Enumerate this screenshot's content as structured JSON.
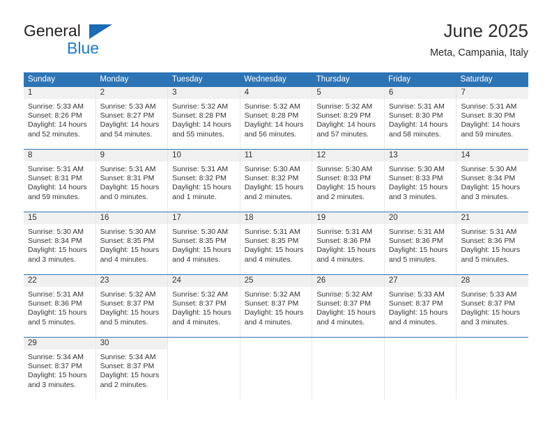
{
  "brand": {
    "name_part1": "General",
    "name_part2": "Blue",
    "accent_color": "#1b7ad1",
    "triangle_color": "#1b6cb5"
  },
  "header": {
    "title": "June 2025",
    "subtitle": "Meta, Campania, Italy"
  },
  "theme": {
    "header_blue": "#2d74b5",
    "daynum_strip": "#f0f0f0",
    "grid_line": "#e7e7e7",
    "text": "#333333"
  },
  "weekdays": [
    "Sunday",
    "Monday",
    "Tuesday",
    "Wednesday",
    "Thursday",
    "Friday",
    "Saturday"
  ],
  "labels": {
    "sunrise_prefix": "Sunrise:",
    "sunset_prefix": "Sunset:",
    "daylight_prefix": "Daylight:"
  },
  "weeks": [
    [
      {
        "day": "1",
        "sunrise": "Sunrise: 5:33 AM",
        "sunset": "Sunset: 8:26 PM",
        "daylight_line1": "Daylight: 14 hours",
        "daylight_line2": "and 52 minutes."
      },
      {
        "day": "2",
        "sunrise": "Sunrise: 5:33 AM",
        "sunset": "Sunset: 8:27 PM",
        "daylight_line1": "Daylight: 14 hours",
        "daylight_line2": "and 54 minutes."
      },
      {
        "day": "3",
        "sunrise": "Sunrise: 5:32 AM",
        "sunset": "Sunset: 8:28 PM",
        "daylight_line1": "Daylight: 14 hours",
        "daylight_line2": "and 55 minutes."
      },
      {
        "day": "4",
        "sunrise": "Sunrise: 5:32 AM",
        "sunset": "Sunset: 8:28 PM",
        "daylight_line1": "Daylight: 14 hours",
        "daylight_line2": "and 56 minutes."
      },
      {
        "day": "5",
        "sunrise": "Sunrise: 5:32 AM",
        "sunset": "Sunset: 8:29 PM",
        "daylight_line1": "Daylight: 14 hours",
        "daylight_line2": "and 57 minutes."
      },
      {
        "day": "6",
        "sunrise": "Sunrise: 5:31 AM",
        "sunset": "Sunset: 8:30 PM",
        "daylight_line1": "Daylight: 14 hours",
        "daylight_line2": "and 58 minutes."
      },
      {
        "day": "7",
        "sunrise": "Sunrise: 5:31 AM",
        "sunset": "Sunset: 8:30 PM",
        "daylight_line1": "Daylight: 14 hours",
        "daylight_line2": "and 59 minutes."
      }
    ],
    [
      {
        "day": "8",
        "sunrise": "Sunrise: 5:31 AM",
        "sunset": "Sunset: 8:31 PM",
        "daylight_line1": "Daylight: 14 hours",
        "daylight_line2": "and 59 minutes."
      },
      {
        "day": "9",
        "sunrise": "Sunrise: 5:31 AM",
        "sunset": "Sunset: 8:31 PM",
        "daylight_line1": "Daylight: 15 hours",
        "daylight_line2": "and 0 minutes."
      },
      {
        "day": "10",
        "sunrise": "Sunrise: 5:31 AM",
        "sunset": "Sunset: 8:32 PM",
        "daylight_line1": "Daylight: 15 hours",
        "daylight_line2": "and 1 minute."
      },
      {
        "day": "11",
        "sunrise": "Sunrise: 5:30 AM",
        "sunset": "Sunset: 8:32 PM",
        "daylight_line1": "Daylight: 15 hours",
        "daylight_line2": "and 2 minutes."
      },
      {
        "day": "12",
        "sunrise": "Sunrise: 5:30 AM",
        "sunset": "Sunset: 8:33 PM",
        "daylight_line1": "Daylight: 15 hours",
        "daylight_line2": "and 2 minutes."
      },
      {
        "day": "13",
        "sunrise": "Sunrise: 5:30 AM",
        "sunset": "Sunset: 8:33 PM",
        "daylight_line1": "Daylight: 15 hours",
        "daylight_line2": "and 3 minutes."
      },
      {
        "day": "14",
        "sunrise": "Sunrise: 5:30 AM",
        "sunset": "Sunset: 8:34 PM",
        "daylight_line1": "Daylight: 15 hours",
        "daylight_line2": "and 3 minutes."
      }
    ],
    [
      {
        "day": "15",
        "sunrise": "Sunrise: 5:30 AM",
        "sunset": "Sunset: 8:34 PM",
        "daylight_line1": "Daylight: 15 hours",
        "daylight_line2": "and 3 minutes."
      },
      {
        "day": "16",
        "sunrise": "Sunrise: 5:30 AM",
        "sunset": "Sunset: 8:35 PM",
        "daylight_line1": "Daylight: 15 hours",
        "daylight_line2": "and 4 minutes."
      },
      {
        "day": "17",
        "sunrise": "Sunrise: 5:30 AM",
        "sunset": "Sunset: 8:35 PM",
        "daylight_line1": "Daylight: 15 hours",
        "daylight_line2": "and 4 minutes."
      },
      {
        "day": "18",
        "sunrise": "Sunrise: 5:31 AM",
        "sunset": "Sunset: 8:35 PM",
        "daylight_line1": "Daylight: 15 hours",
        "daylight_line2": "and 4 minutes."
      },
      {
        "day": "19",
        "sunrise": "Sunrise: 5:31 AM",
        "sunset": "Sunset: 8:36 PM",
        "daylight_line1": "Daylight: 15 hours",
        "daylight_line2": "and 4 minutes."
      },
      {
        "day": "20",
        "sunrise": "Sunrise: 5:31 AM",
        "sunset": "Sunset: 8:36 PM",
        "daylight_line1": "Daylight: 15 hours",
        "daylight_line2": "and 5 minutes."
      },
      {
        "day": "21",
        "sunrise": "Sunrise: 5:31 AM",
        "sunset": "Sunset: 8:36 PM",
        "daylight_line1": "Daylight: 15 hours",
        "daylight_line2": "and 5 minutes."
      }
    ],
    [
      {
        "day": "22",
        "sunrise": "Sunrise: 5:31 AM",
        "sunset": "Sunset: 8:36 PM",
        "daylight_line1": "Daylight: 15 hours",
        "daylight_line2": "and 5 minutes."
      },
      {
        "day": "23",
        "sunrise": "Sunrise: 5:32 AM",
        "sunset": "Sunset: 8:37 PM",
        "daylight_line1": "Daylight: 15 hours",
        "daylight_line2": "and 5 minutes."
      },
      {
        "day": "24",
        "sunrise": "Sunrise: 5:32 AM",
        "sunset": "Sunset: 8:37 PM",
        "daylight_line1": "Daylight: 15 hours",
        "daylight_line2": "and 4 minutes."
      },
      {
        "day": "25",
        "sunrise": "Sunrise: 5:32 AM",
        "sunset": "Sunset: 8:37 PM",
        "daylight_line1": "Daylight: 15 hours",
        "daylight_line2": "and 4 minutes."
      },
      {
        "day": "26",
        "sunrise": "Sunrise: 5:32 AM",
        "sunset": "Sunset: 8:37 PM",
        "daylight_line1": "Daylight: 15 hours",
        "daylight_line2": "and 4 minutes."
      },
      {
        "day": "27",
        "sunrise": "Sunrise: 5:33 AM",
        "sunset": "Sunset: 8:37 PM",
        "daylight_line1": "Daylight: 15 hours",
        "daylight_line2": "and 4 minutes."
      },
      {
        "day": "28",
        "sunrise": "Sunrise: 5:33 AM",
        "sunset": "Sunset: 8:37 PM",
        "daylight_line1": "Daylight: 15 hours",
        "daylight_line2": "and 3 minutes."
      }
    ],
    [
      {
        "day": "29",
        "sunrise": "Sunrise: 5:34 AM",
        "sunset": "Sunset: 8:37 PM",
        "daylight_line1": "Daylight: 15 hours",
        "daylight_line2": "and 3 minutes."
      },
      {
        "day": "30",
        "sunrise": "Sunrise: 5:34 AM",
        "sunset": "Sunset: 8:37 PM",
        "daylight_line1": "Daylight: 15 hours",
        "daylight_line2": "and 2 minutes."
      },
      {
        "day": "",
        "sunrise": "",
        "sunset": "",
        "daylight_line1": "",
        "daylight_line2": ""
      },
      {
        "day": "",
        "sunrise": "",
        "sunset": "",
        "daylight_line1": "",
        "daylight_line2": ""
      },
      {
        "day": "",
        "sunrise": "",
        "sunset": "",
        "daylight_line1": "",
        "daylight_line2": ""
      },
      {
        "day": "",
        "sunrise": "",
        "sunset": "",
        "daylight_line1": "",
        "daylight_line2": ""
      },
      {
        "day": "",
        "sunrise": "",
        "sunset": "",
        "daylight_line1": "",
        "daylight_line2": ""
      }
    ]
  ]
}
